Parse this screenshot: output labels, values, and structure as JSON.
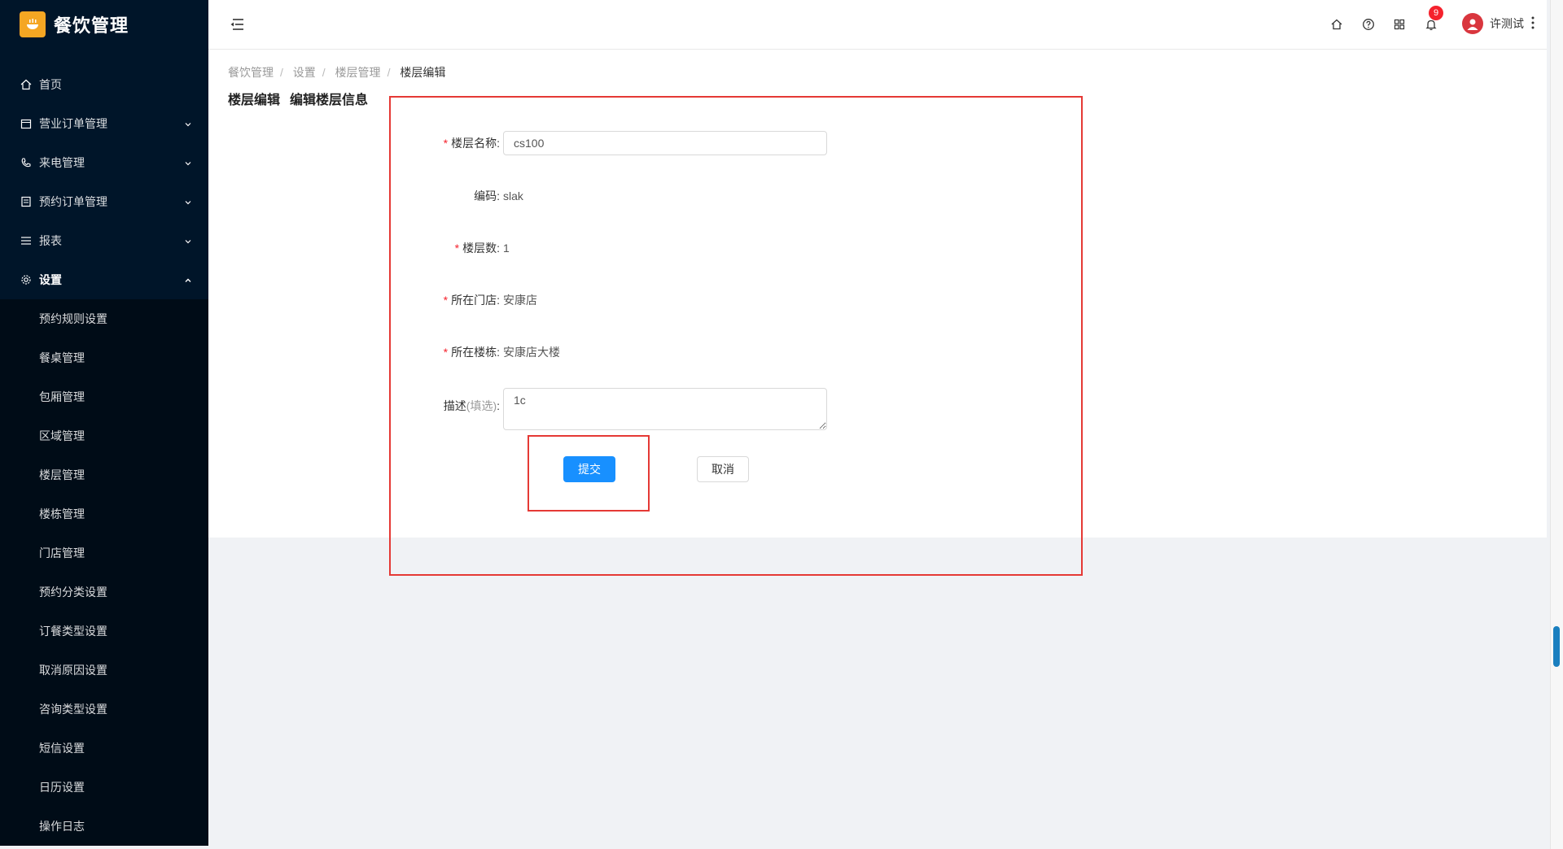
{
  "app": {
    "title": "餐饮管理"
  },
  "sidebar": {
    "menu": [
      {
        "label": "首页",
        "icon": "home-icon"
      },
      {
        "label": "营业订单管理",
        "icon": "calendar-icon"
      },
      {
        "label": "来电管理",
        "icon": "phone-icon"
      },
      {
        "label": "预约订单管理",
        "icon": "list-icon"
      },
      {
        "label": "报表",
        "icon": "menu-icon"
      },
      {
        "label": "设置",
        "icon": "gear-icon"
      }
    ],
    "submenu": [
      "预约规则设置",
      "餐桌管理",
      "包厢管理",
      "区域管理",
      "楼层管理",
      "楼栋管理",
      "门店管理",
      "预约分类设置",
      "订餐类型设置",
      "取消原因设置",
      "咨询类型设置",
      "短信设置",
      "日历设置",
      "操作日志"
    ]
  },
  "header": {
    "notification_count": "9",
    "user_name": "许测试"
  },
  "breadcrumb": [
    "餐饮管理",
    "设置",
    "楼层管理",
    "楼层编辑"
  ],
  "page": {
    "title": "楼层编辑",
    "subtitle": "编辑楼层信息"
  },
  "form": {
    "floor_name": {
      "label": "楼层名称:",
      "value": "cs100"
    },
    "code": {
      "label": "编码:",
      "value": "slak"
    },
    "floor_count": {
      "label": "楼层数:",
      "value": "1"
    },
    "store": {
      "label": "所在门店:",
      "value": "安康店"
    },
    "building": {
      "label": "所在楼栋:",
      "value": "安康店大楼"
    },
    "description": {
      "label": "描述",
      "optional": "(填选)",
      "colon": ":",
      "value": "1c"
    },
    "submit_label": "提交",
    "cancel_label": "取消"
  },
  "colors": {
    "sidebar": "#001529",
    "primary": "#1890ff",
    "highlight": "#e53935"
  }
}
